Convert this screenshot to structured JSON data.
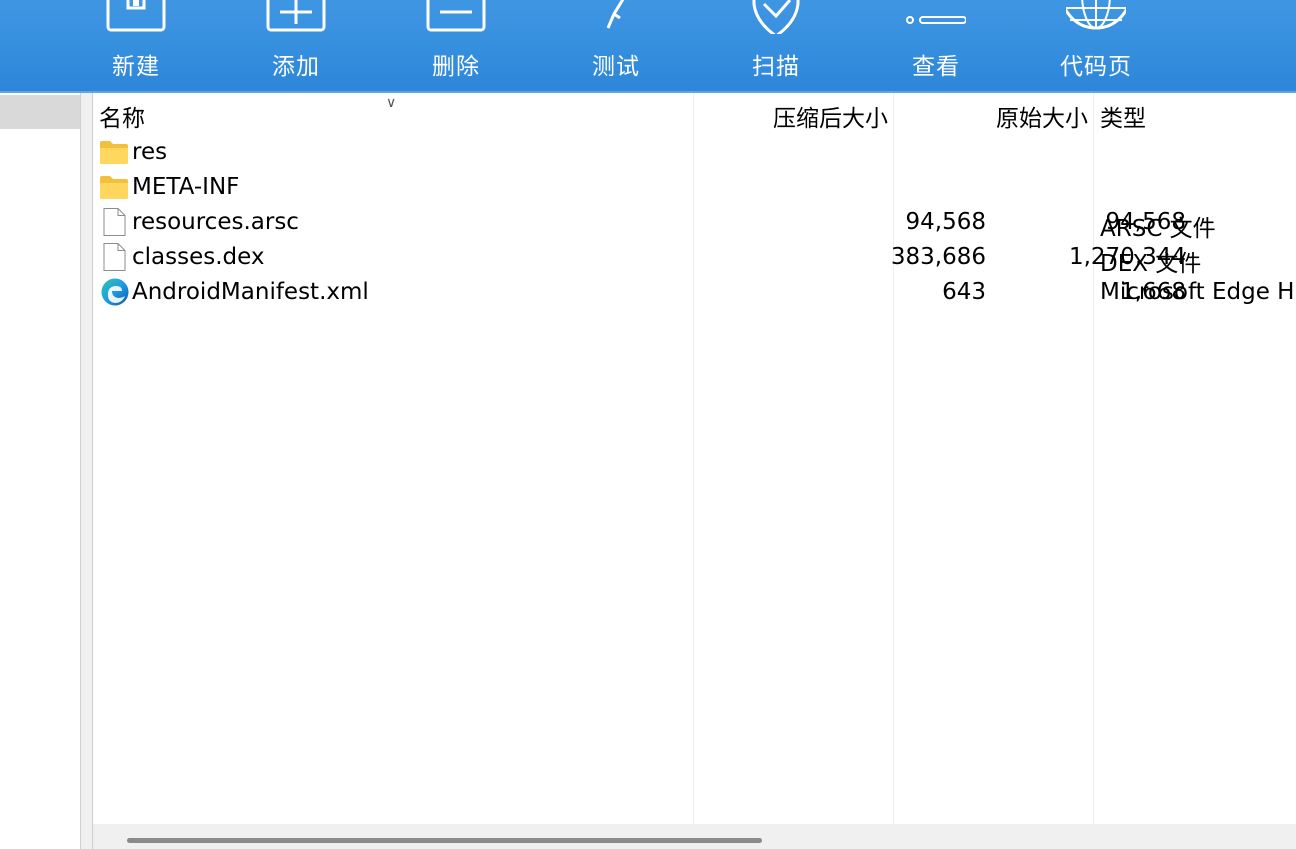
{
  "toolbar": {
    "buttons": [
      {
        "label": "新建",
        "icon": "new-archive-icon"
      },
      {
        "label": "添加",
        "icon": "add-icon"
      },
      {
        "label": "删除",
        "icon": "delete-icon"
      },
      {
        "label": "测试",
        "icon": "test-icon"
      },
      {
        "label": "扫描",
        "icon": "scan-shield-icon"
      },
      {
        "label": "查看",
        "icon": "view-icon"
      },
      {
        "label": "代码页",
        "icon": "codepage-globe-icon"
      }
    ],
    "colors": {
      "background": "#2d86d9",
      "text": "#ffffff"
    }
  },
  "list": {
    "columns": {
      "name": "名称",
      "compressed": "压缩后大小",
      "original": "原始大小",
      "type": "类型"
    },
    "sort_indicator": "∨",
    "rows": [
      {
        "name": "res",
        "compressed": "",
        "original": "",
        "type": "",
        "icon": "folder-icon"
      },
      {
        "name": "META-INF",
        "compressed": "",
        "original": "",
        "type": "",
        "icon": "folder-icon"
      },
      {
        "name": "resources.arsc",
        "compressed": "94,568",
        "original": "94,568",
        "type": "ARSC 文件",
        "icon": "file-icon"
      },
      {
        "name": "classes.dex",
        "compressed": "383,686",
        "original": "1,270,344",
        "type": "DEX 文件",
        "icon": "file-icon"
      },
      {
        "name": "AndroidManifest.xml",
        "compressed": "643",
        "original": "1,668",
        "type": "Microsoft Edge H",
        "icon": "edge-icon"
      }
    ]
  },
  "scrollbar": {
    "horizontal_position": 0.0
  }
}
